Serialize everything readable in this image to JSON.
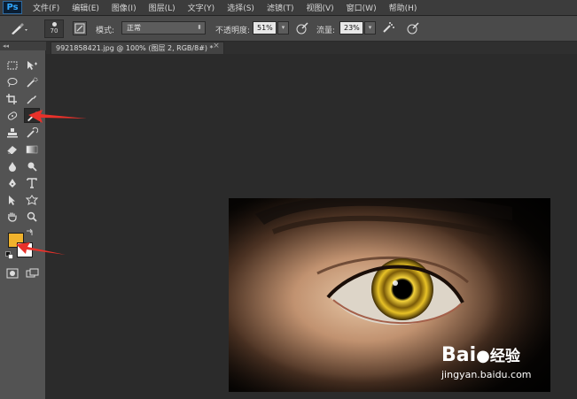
{
  "app": {
    "logo": "Ps"
  },
  "menu": [
    "文件(F)",
    "编辑(E)",
    "图像(I)",
    "图层(L)",
    "文字(Y)",
    "选择(S)",
    "滤镜(T)",
    "视图(V)",
    "窗口(W)",
    "帮助(H)"
  ],
  "options": {
    "brush_size": "70",
    "mode_label": "模式:",
    "mode_value": "正常",
    "opacity_label": "不透明度:",
    "opacity_value": "51%",
    "flow_label": "流量:",
    "flow_value": "23%"
  },
  "document": {
    "tab_title": "9921858421.jpg @ 100% (图层 2, RGB/8#) *",
    "close": "×"
  },
  "toolbox": {
    "collapse": "◂◂",
    "foreground_color": "#f0b22c",
    "background_color": "#ffffff"
  },
  "watermark": {
    "brand": "Bai",
    "brand_suffix": "经验",
    "url": "jingyan.baidu.com"
  },
  "accent_colors": {
    "arrow": "#e8312a",
    "ps_blue": "#31a8ff"
  }
}
